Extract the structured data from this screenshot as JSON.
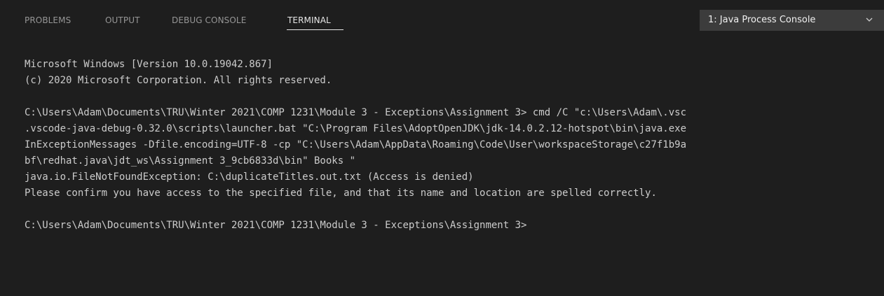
{
  "tabs": [
    {
      "label": "PROBLEMS",
      "active": false
    },
    {
      "label": "OUTPUT",
      "active": false
    },
    {
      "label": "DEBUG CONSOLE",
      "active": false
    },
    {
      "label": "TERMINAL",
      "active": true
    }
  ],
  "terminal_selector": {
    "selected": "1: Java Process Console",
    "icon": "chevron-down-icon"
  },
  "terminal_lines": [
    "Microsoft Windows [Version 10.0.19042.867]",
    "(c) 2020 Microsoft Corporation. All rights reserved.",
    "",
    "C:\\Users\\Adam\\Documents\\TRU\\Winter 2021\\COMP 1231\\Module 3 - Exceptions\\Assignment 3> cmd /C \"c:\\Users\\Adam\\.vsc",
    ".vscode-java-debug-0.32.0\\scripts\\launcher.bat \"C:\\Program Files\\AdoptOpenJDK\\jdk-14.0.2.12-hotspot\\bin\\java.exe",
    "InExceptionMessages -Dfile.encoding=UTF-8 -cp \"C:\\Users\\Adam\\AppData\\Roaming\\Code\\User\\workspaceStorage\\c27f1b9a",
    "bf\\redhat.java\\jdt_ws\\Assignment 3_9cb6833d\\bin\" Books \"",
    "java.io.FileNotFoundException: C:\\duplicateTitles.out.txt (Access is denied)",
    "Please confirm you have access to the specified file, and that its name and location are spelled correctly.",
    "",
    "C:\\Users\\Adam\\Documents\\TRU\\Winter 2021\\COMP 1231\\Module 3 - Exceptions\\Assignment 3>"
  ],
  "colors": {
    "background": "#1e1e1e",
    "text": "#cccccc",
    "tab_inactive": "#969696",
    "tab_active": "#e7e7e7",
    "dropdown_bg": "#3c3c3c"
  }
}
